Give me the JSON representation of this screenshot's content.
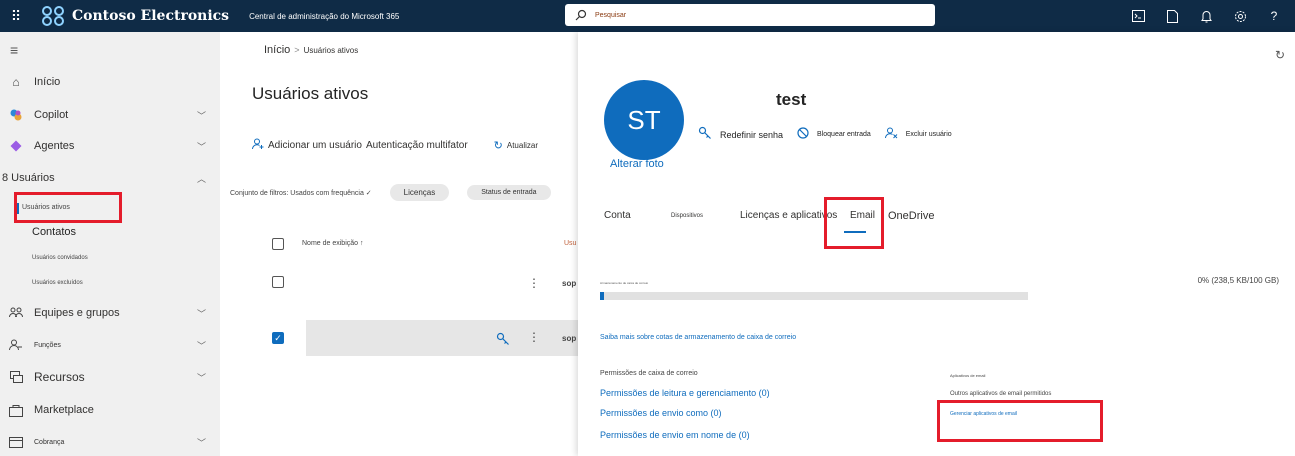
{
  "topbar": {
    "brand": "Contoso Electronics",
    "admin_center": "Central de administração do Microsoft 365",
    "search_placeholder": "Pesquisar",
    "help": "?"
  },
  "sidebar": {
    "items": [
      {
        "label": "Início",
        "icon": "home-icon"
      },
      {
        "label": "Copilot",
        "icon": "copilot-icon"
      },
      {
        "label": "Agentes",
        "icon": "agents-icon"
      },
      {
        "label": "8 Usuários"
      },
      {
        "label": "Equipes e grupos",
        "icon": "teams-icon"
      },
      {
        "label": "Funções",
        "icon": "roles-icon"
      },
      {
        "label": "Recursos",
        "icon": "resources-icon"
      },
      {
        "label": "Marketplace",
        "icon": "marketplace-icon"
      },
      {
        "label": "Cobrança",
        "icon": "billing-icon"
      }
    ],
    "users_sub": [
      "Usuários ativos",
      "Contatos",
      "Usuários convidados",
      "Usuários excluídos"
    ]
  },
  "main": {
    "breadcrumb_home": "Início",
    "breadcrumb_current": "Usuários ativos",
    "title": "Usuários ativos",
    "toolbar": {
      "add_user": "Adicionar um usuário",
      "mfa": "Autenticação multifator",
      "refresh": "Atualizar"
    },
    "filters": {
      "label": "Conjunto de filtros: Usados com frequência ✓",
      "licenses": "Licenças",
      "signin_status": "Status de entrada"
    },
    "table": {
      "col_display_name": "Nome de exibição ↑",
      "col_user": "Usu",
      "rows": [
        {
          "user": "sop",
          "selected": false
        },
        {
          "user": "sop",
          "selected": true
        }
      ]
    }
  },
  "panel": {
    "initials": "ST",
    "change_photo": "Alterar foto",
    "name": "test",
    "actions": {
      "reset_password": "Redefinir senha",
      "block_signin": "Bloquear entrada",
      "delete_user": "Excluir usuário"
    },
    "tabs": [
      "Conta",
      "Dispositivos",
      "Licenças e aplicativos",
      "Email",
      "OneDrive"
    ],
    "active_tab": "Email",
    "mailbox": {
      "storage_label": "Armazenamento de caixa de correio",
      "usage": "0% (238,5 KB/100 GB)",
      "usage_fraction": 0.0024,
      "quota_link": "Saiba mais sobre cotas de armazenamento de caixa de correio"
    },
    "permissions": {
      "header": "Permissões de caixa de correio",
      "read_manage": "Permissões de leitura e gerenciamento (0)",
      "send_as": "Permissões de envio como (0)",
      "send_on_behalf": "Permissões de envio em nome de (0)"
    },
    "email_apps": {
      "header": "Aplicativos de email",
      "allowed": "Outros aplicativos de email permitidos",
      "manage": "Gerenciar aplicativos de email"
    }
  },
  "colors": {
    "topbar": "#0f2b46",
    "accent": "#0f6cbd",
    "highlight": "#e41c2b",
    "sidebar": "#f0f0f0"
  }
}
